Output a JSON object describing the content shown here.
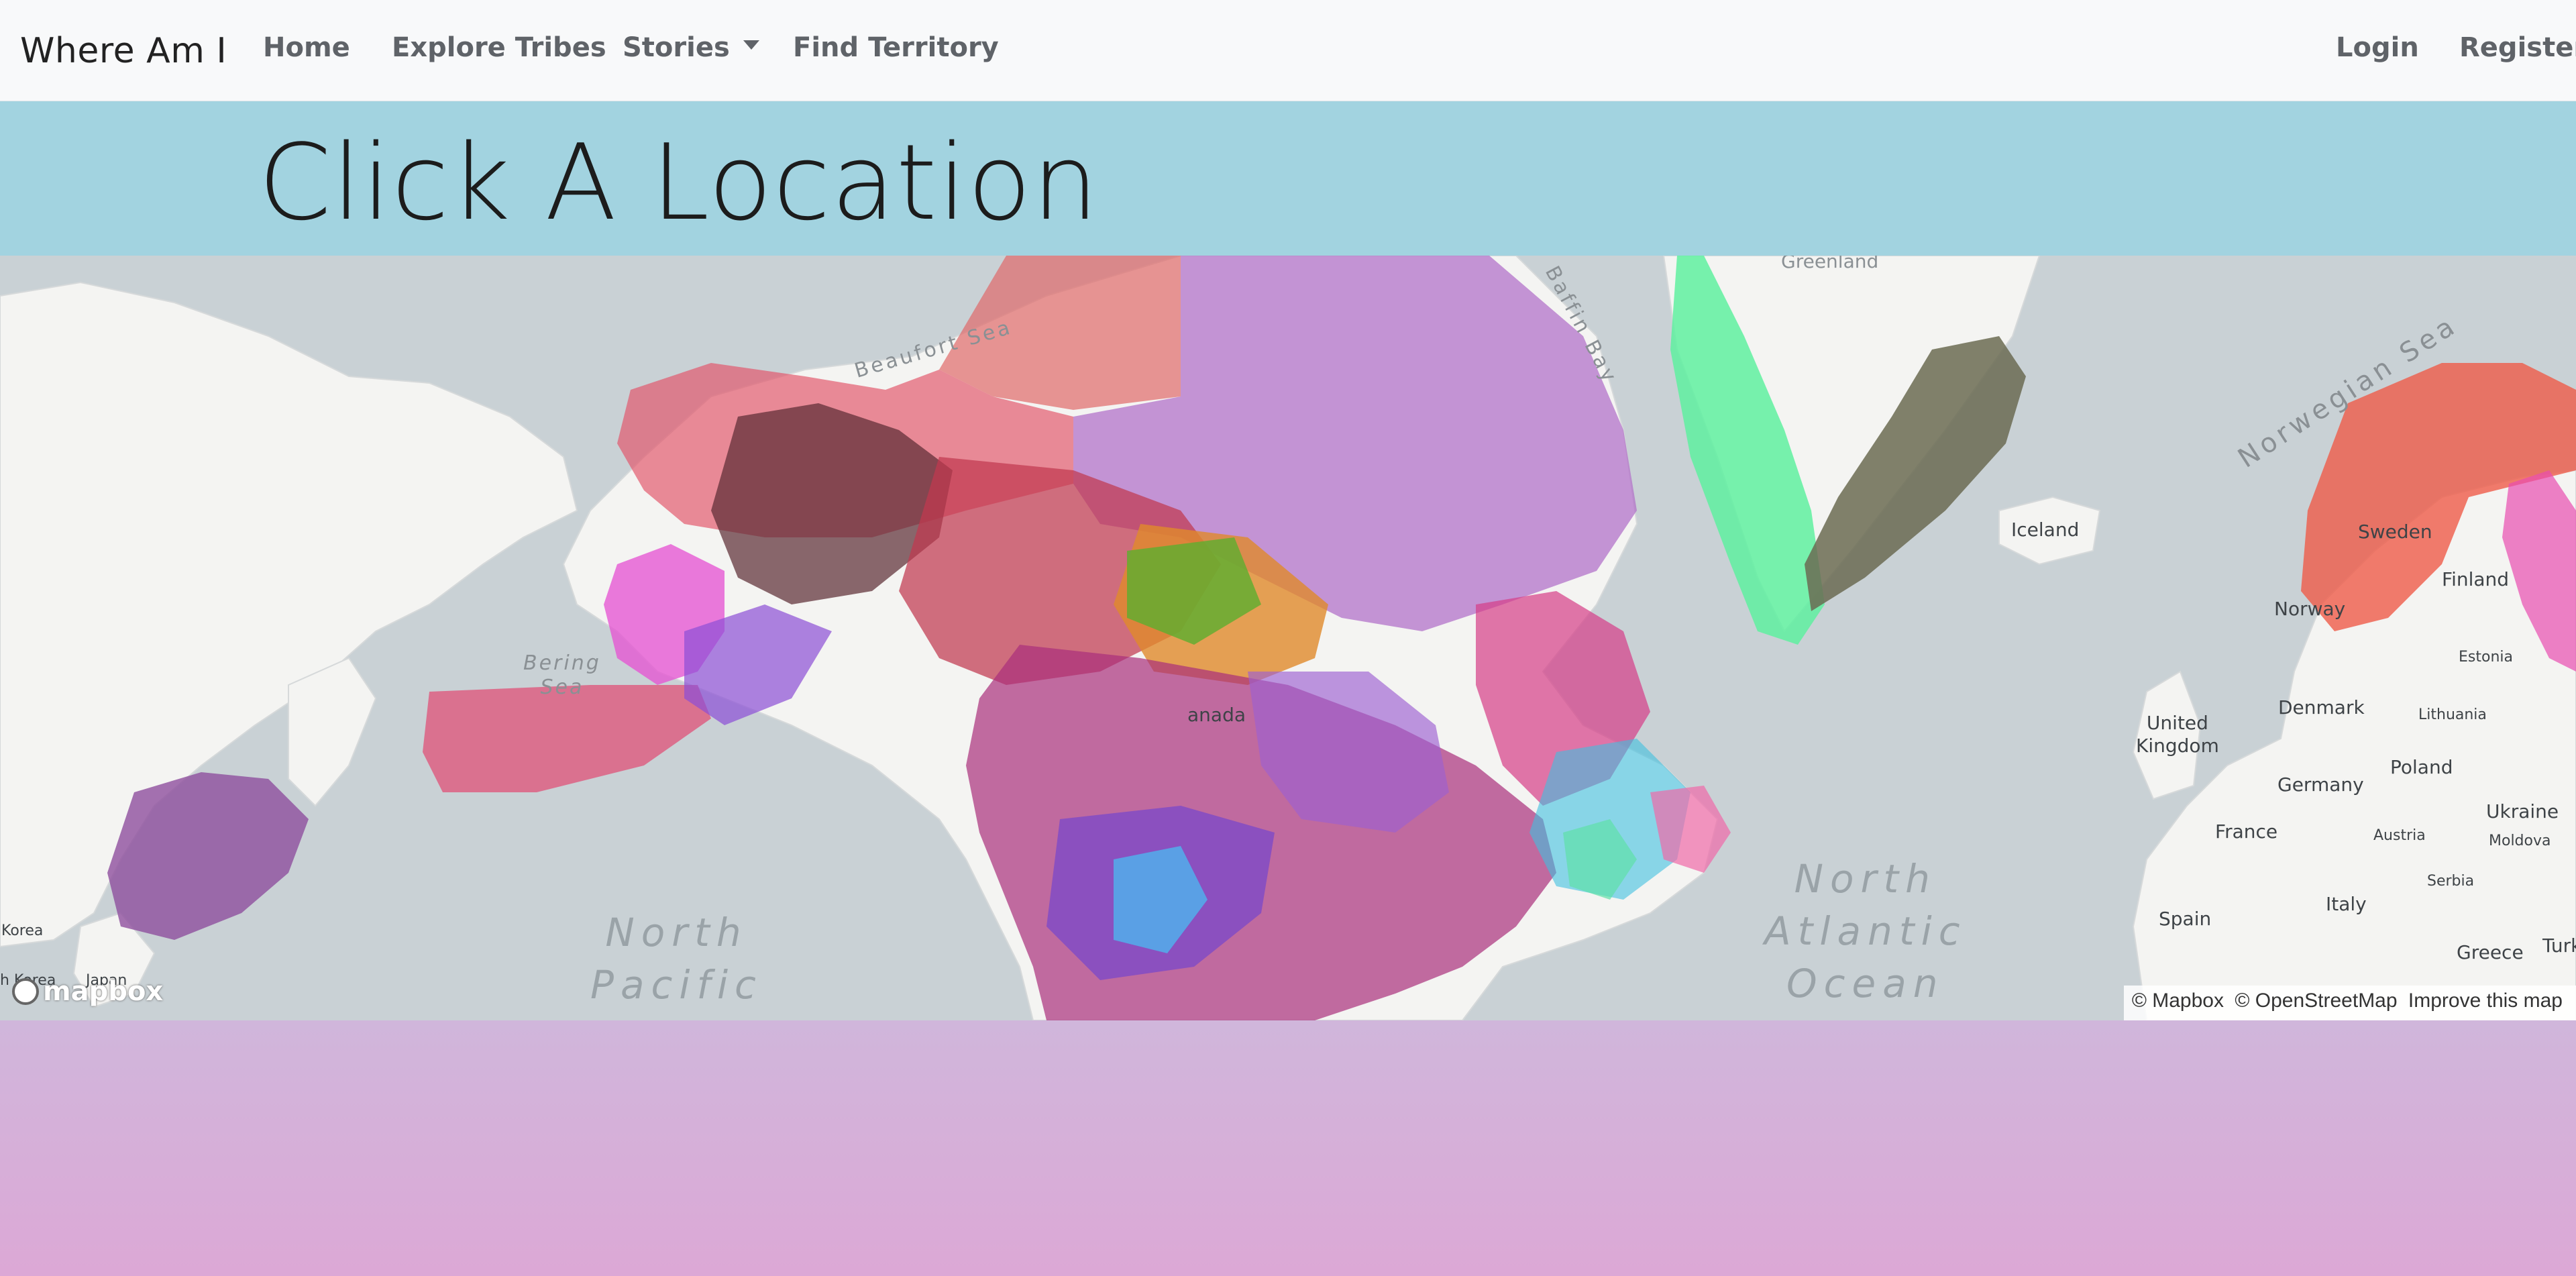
{
  "navbar": {
    "brand": "Where Am I",
    "links": {
      "home": "Home",
      "explore": "Explore Tribes",
      "stories": "Stories",
      "find": "Find Territory"
    },
    "auth": {
      "login": "Login",
      "register": "Register"
    }
  },
  "hero": {
    "title": "Click A Location"
  },
  "map": {
    "ocean_labels": {
      "north_pacific": "North\nPacific",
      "north_atlantic": "North\nAtlantic\nOcean",
      "beaufort": "Beaufort Sea",
      "baffin": "Baffin Bay",
      "bering": "Bering\nSea",
      "norwegian": "Norwegian Sea"
    },
    "place_labels": {
      "greenland": "Greenland",
      "iceland": "Iceland",
      "sweden": "Sweden",
      "finland": "Finland",
      "norway": "Norway",
      "estonia": "Estonia",
      "denmark": "Denmark",
      "lithuania": "Lithuania",
      "uk": "United\nKingdom",
      "poland": "Poland",
      "germany": "Germany",
      "ukraine": "Ukraine",
      "france": "France",
      "austria": "Austria",
      "moldova": "Moldova",
      "serbia": "Serbia",
      "italy": "Italy",
      "spain": "Spain",
      "greece": "Greece",
      "turkey": "Turke",
      "korea": "Korea",
      "japan": "Japan",
      "canada": "anada",
      "nkorea": "h Korea"
    },
    "logo_text": "mapbox",
    "attribution": {
      "mapbox": "© Mapbox",
      "osm": "© OpenStreetMap",
      "improve": "Improve this map"
    }
  }
}
